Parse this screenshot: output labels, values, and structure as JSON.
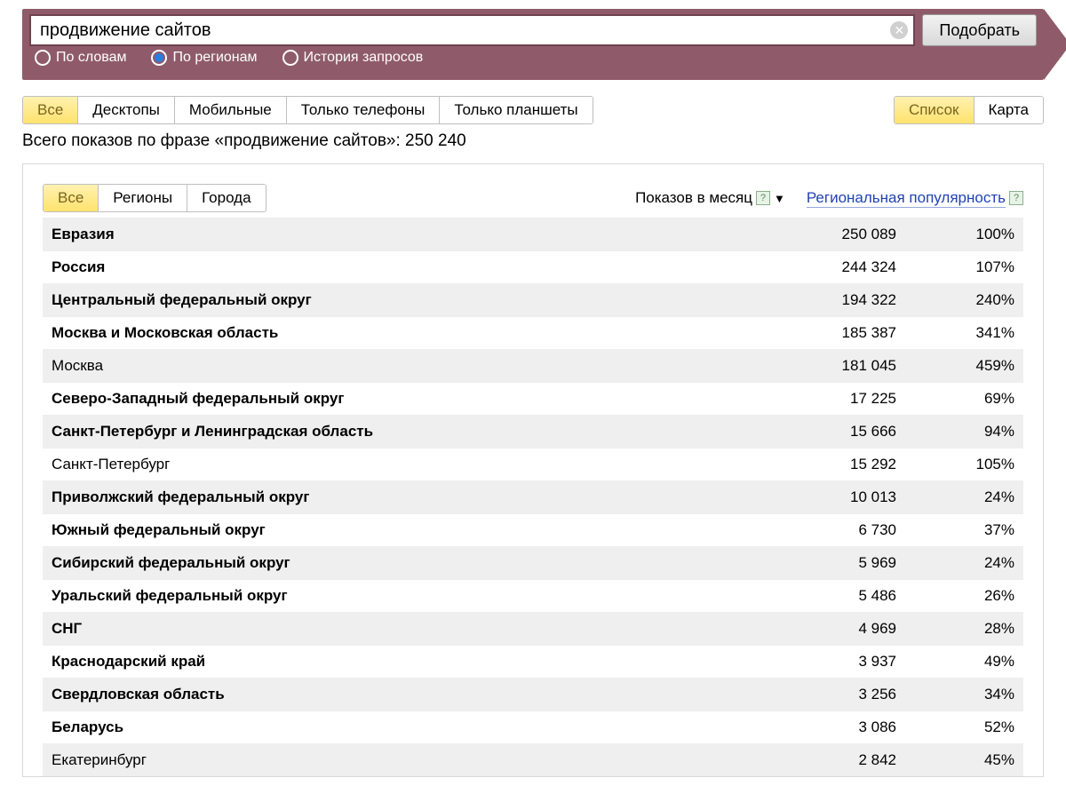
{
  "search": {
    "value": "продвижение сайтов",
    "submit": "Подобрать"
  },
  "modes": {
    "words": "По словам",
    "regions": "По регионам",
    "history": "История запросов",
    "selected": "regions"
  },
  "device_tabs": {
    "items": [
      "Все",
      "Десктопы",
      "Мобильные",
      "Только телефоны",
      "Только планшеты"
    ],
    "active": 0
  },
  "view_tabs": {
    "items": [
      "Список",
      "Карта"
    ],
    "active": 0
  },
  "summary": "Всего показов по фразе «продвижение сайтов»: 250 240",
  "scope_tabs": {
    "items": [
      "Все",
      "Регионы",
      "Города"
    ],
    "active": 0
  },
  "columns": {
    "impressions": "Показов в месяц",
    "popularity": "Региональная популярность"
  },
  "rows": [
    {
      "name": "Евразия",
      "impressions": "250 089",
      "pop": "100%",
      "bold": true,
      "shade": true
    },
    {
      "name": "Россия",
      "impressions": "244 324",
      "pop": "107%",
      "bold": true,
      "shade": false
    },
    {
      "name": "Центральный федеральный округ",
      "impressions": "194 322",
      "pop": "240%",
      "bold": true,
      "shade": true
    },
    {
      "name": "Москва и Московская область",
      "impressions": "185 387",
      "pop": "341%",
      "bold": true,
      "shade": false
    },
    {
      "name": "Москва",
      "impressions": "181 045",
      "pop": "459%",
      "bold": false,
      "shade": true
    },
    {
      "name": "Северо-Западный федеральный округ",
      "impressions": "17 225",
      "pop": "69%",
      "bold": true,
      "shade": false
    },
    {
      "name": "Санкт-Петербург и Ленинградская область",
      "impressions": "15 666",
      "pop": "94%",
      "bold": true,
      "shade": true
    },
    {
      "name": "Санкт-Петербург",
      "impressions": "15 292",
      "pop": "105%",
      "bold": false,
      "shade": false
    },
    {
      "name": "Приволжский федеральный округ",
      "impressions": "10 013",
      "pop": "24%",
      "bold": true,
      "shade": true
    },
    {
      "name": "Южный федеральный округ",
      "impressions": "6 730",
      "pop": "37%",
      "bold": true,
      "shade": false
    },
    {
      "name": "Сибирский федеральный округ",
      "impressions": "5 969",
      "pop": "24%",
      "bold": true,
      "shade": true
    },
    {
      "name": "Уральский федеральный округ",
      "impressions": "5 486",
      "pop": "26%",
      "bold": true,
      "shade": false
    },
    {
      "name": "СНГ",
      "impressions": "4 969",
      "pop": "28%",
      "bold": true,
      "shade": true
    },
    {
      "name": "Краснодарский край",
      "impressions": "3 937",
      "pop": "49%",
      "bold": true,
      "shade": false
    },
    {
      "name": "Свердловская область",
      "impressions": "3 256",
      "pop": "34%",
      "bold": true,
      "shade": true
    },
    {
      "name": "Беларусь",
      "impressions": "3 086",
      "pop": "52%",
      "bold": true,
      "shade": false
    },
    {
      "name": "Екатеринбург",
      "impressions": "2 842",
      "pop": "45%",
      "bold": false,
      "shade": true
    }
  ]
}
